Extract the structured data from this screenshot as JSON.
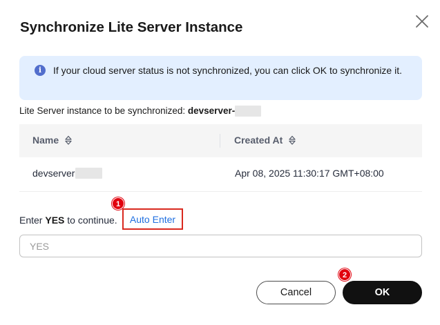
{
  "dialog": {
    "title": "Synchronize Lite Server Instance",
    "close_icon": "close-icon"
  },
  "info": {
    "icon": "info-icon",
    "icon_glyph": "i",
    "text": "If your cloud server status is not synchronized, you can click OK to synchronize it."
  },
  "instance": {
    "label": "Lite Server instance to be synchronized:",
    "name": "devserver-"
  },
  "table": {
    "columns": [
      "Name",
      "Created At"
    ],
    "rows": [
      {
        "name": "devserver",
        "created_at": "Apr 08, 2025 11:30:17 GMT+08:00"
      }
    ]
  },
  "confirm": {
    "prefix": "Enter",
    "keyword": "YES",
    "suffix": "to continue.",
    "auto_enter": "Auto Enter",
    "input_placeholder": "YES",
    "input_value": ""
  },
  "markers": [
    "1",
    "2"
  ],
  "buttons": {
    "cancel": "Cancel",
    "ok": "OK"
  },
  "colors": {
    "info_bg": "#e3efff",
    "link": "#1f6fe0",
    "highlight": "#d9281e",
    "primary": "#111111"
  }
}
